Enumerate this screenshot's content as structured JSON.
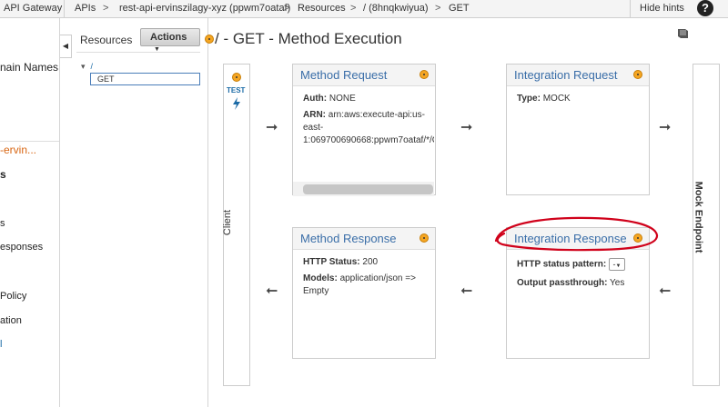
{
  "topbar": {
    "service": "API Gateway",
    "crumbs": [
      "APIs",
      ">",
      "rest-api-ervinszilagy-xyz (ppwm7oataf)",
      ">",
      "Resources",
      ">",
      "/ (8hnqkwiyua)",
      ">",
      "GET"
    ],
    "hide_hints": "Hide hints",
    "help": "?"
  },
  "leftnav": {
    "items": [
      "nain Names",
      "-ervin...",
      "s",
      "s",
      "esponses",
      "Policy",
      "ation",
      "l"
    ]
  },
  "resources": {
    "title": "Resources",
    "actions_label": "Actions",
    "tree_root": "/",
    "selected_method": "GET"
  },
  "page": {
    "title": "/ - GET - Method Execution"
  },
  "client": {
    "test_label": "TEST",
    "label": "Client"
  },
  "mock_endpoint": {
    "label": "Mock Endpoint"
  },
  "method_request": {
    "title": "Method Request",
    "auth_label": "Auth:",
    "auth_value": "NONE",
    "arn_label": "ARN:",
    "arn_line1": "arn:aws:execute-api:us-",
    "arn_line2": "east-",
    "arn_line3": "1:069700690668:ppwm7oataf/*/G"
  },
  "integration_request": {
    "title": "Integration Request",
    "type_label": "Type:",
    "type_value": "MOCK"
  },
  "method_response": {
    "title": "Method Response",
    "status_label": "HTTP Status:",
    "status_value": "200",
    "models_label": "Models:",
    "models_value_line1": "application/json =>",
    "models_value_line2": "Empty"
  },
  "integration_response": {
    "title": "Integration Response",
    "pattern_label": "HTTP status pattern:",
    "pattern_value": "-",
    "passthrough_label": "Output passthrough:",
    "passthrough_value": "Yes"
  },
  "icons": {
    "hint_color": "#f5a623",
    "annotation_color": "#d0021b",
    "link_color": "#3a6ea8"
  }
}
